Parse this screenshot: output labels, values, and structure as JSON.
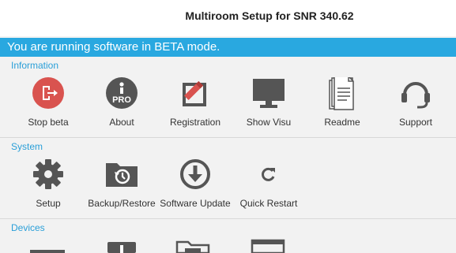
{
  "header": {
    "title": "Multiroom Setup for SNR 340.62"
  },
  "banner": {
    "text": "You are running software in BETA mode."
  },
  "sections": {
    "information": {
      "label": "Information",
      "items": [
        {
          "label": "Stop beta",
          "icon": "stop-beta-icon"
        },
        {
          "label": "About",
          "icon": "info-pro-icon"
        },
        {
          "label": "Registration",
          "icon": "registration-icon"
        },
        {
          "label": "Show Visu",
          "icon": "monitor-icon"
        },
        {
          "label": "Readme",
          "icon": "document-icon"
        },
        {
          "label": "Support",
          "icon": "headset-icon"
        }
      ]
    },
    "system": {
      "label": "System",
      "items": [
        {
          "label": "Setup",
          "icon": "gear-icon"
        },
        {
          "label": "Backup/Restore",
          "icon": "backup-folder-icon"
        },
        {
          "label": "Software Update",
          "icon": "download-icon"
        },
        {
          "label": "Quick Restart",
          "icon": "restart-icon"
        }
      ]
    },
    "devices": {
      "label": "Devices"
    }
  },
  "colors": {
    "accent": "#29a8e0",
    "stop_beta": "#d9534f",
    "icon_dark": "#555555",
    "section_label": "#2a9fd8"
  }
}
